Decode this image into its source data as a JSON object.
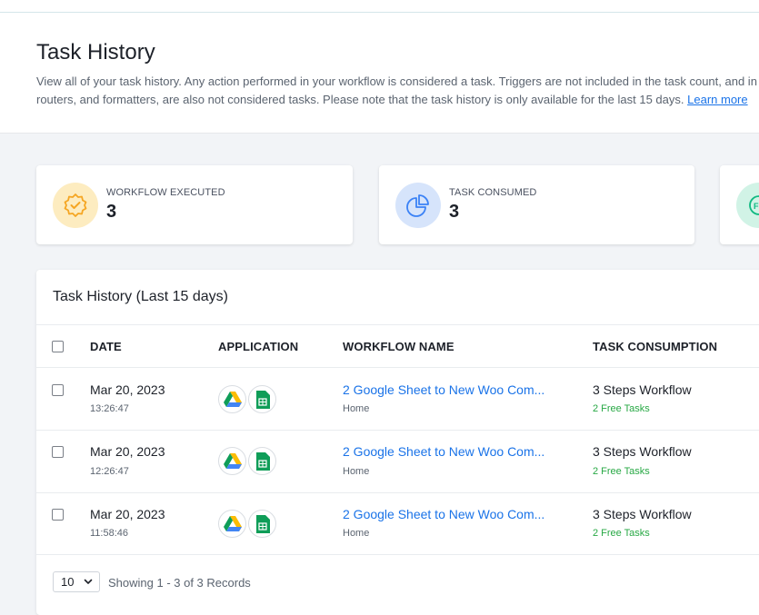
{
  "header": {
    "title": "Task History",
    "description_line1": "View all of your task history. Any action performed in your workflow is considered a task. Triggers are not included in the task count, and in",
    "description_line2": "routers, and formatters, are also not considered tasks. Please note that the task history is only available for the last 15 days.",
    "learn_more": "Learn more"
  },
  "stats": [
    {
      "label": "WORKFLOW EXECUTED",
      "value": "3",
      "icon": "badge-check-icon",
      "color": "#f5a623"
    },
    {
      "label": "TASK CONSUMED",
      "value": "3",
      "icon": "pie-chart-icon",
      "color": "#3b82f6"
    },
    {
      "label": "",
      "value": "",
      "icon": "free-badge-icon",
      "color": "#10b981"
    }
  ],
  "table": {
    "title": "Task History (Last 15 days)",
    "columns": [
      "DATE",
      "APPLICATION",
      "WORKFLOW NAME",
      "TASK CONSUMPTION"
    ],
    "rows": [
      {
        "date": "Mar 20, 2023",
        "time": "13:26:47",
        "apps": [
          "google-drive-icon",
          "google-sheets-icon"
        ],
        "workflow": "2 Google Sheet to New Woo Com...",
        "folder": "Home",
        "consumption": "3 Steps Workflow",
        "free_tasks": "2 Free Tasks"
      },
      {
        "date": "Mar 20, 2023",
        "time": "12:26:47",
        "apps": [
          "google-drive-icon",
          "google-sheets-icon"
        ],
        "workflow": "2 Google Sheet to New Woo Com...",
        "folder": "Home",
        "consumption": "3 Steps Workflow",
        "free_tasks": "2 Free Tasks"
      },
      {
        "date": "Mar 20, 2023",
        "time": "11:58:46",
        "apps": [
          "google-drive-icon",
          "google-sheets-icon"
        ],
        "workflow": "2 Google Sheet to New Woo Com...",
        "folder": "Home",
        "consumption": "3 Steps Workflow",
        "free_tasks": "2 Free Tasks"
      }
    ]
  },
  "pagination": {
    "page_size": "10",
    "summary": "Showing 1 - 3 of 3 Records"
  },
  "colors": {
    "link": "#1a73e8",
    "free_tasks": "#27a844",
    "background": "#f2f4f7"
  }
}
